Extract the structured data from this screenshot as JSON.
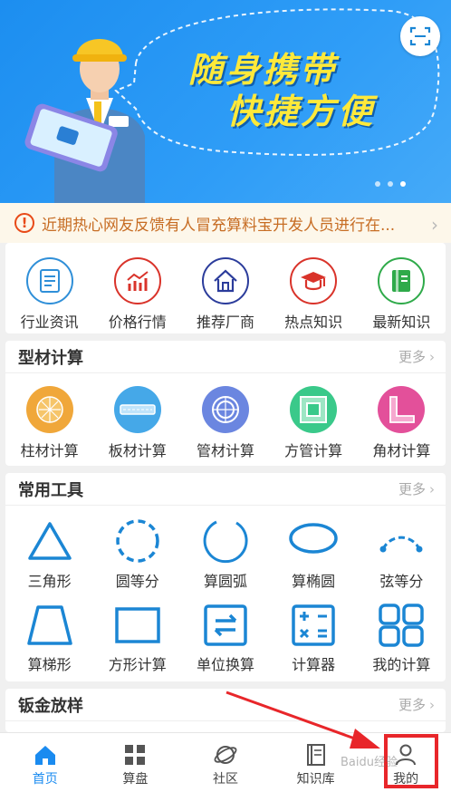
{
  "banner": {
    "slogan_line1": "随身携带",
    "slogan_line2": "快捷方便",
    "scan_icon": "scan-icon",
    "carousel_dots": 3
  },
  "notice": {
    "icon": "alert-icon",
    "icon_text": "!",
    "text": "近期热心网友反馈有人冒充算料宝开发人员进行在...",
    "arrow": "›"
  },
  "quick_nav": {
    "items": [
      {
        "label": "行业资讯",
        "icon": "document-icon",
        "color": "#2f8fd8"
      },
      {
        "label": "价格行情",
        "icon": "bar-chart-icon",
        "color": "#d9332a"
      },
      {
        "label": "推荐厂商",
        "icon": "house-icon",
        "color": "#2b3c9b"
      },
      {
        "label": "热点知识",
        "icon": "graduation-cap-icon",
        "color": "#d9332a"
      },
      {
        "label": "最新知识",
        "icon": "book-icon",
        "color": "#2faa4a"
      }
    ]
  },
  "profile_calc": {
    "title": "型材计算",
    "more": "更多",
    "items": [
      {
        "label": "柱材计算",
        "icon": "column-icon",
        "color": "#f0a73a"
      },
      {
        "label": "板材计算",
        "icon": "plate-icon",
        "color": "#45a8e8"
      },
      {
        "label": "管材计算",
        "icon": "pipe-icon",
        "color": "#6b86e0"
      },
      {
        "label": "方管计算",
        "icon": "square-tube-icon",
        "color": "#3ac98a"
      },
      {
        "label": "角材计算",
        "icon": "angle-icon",
        "color": "#e3509a"
      }
    ]
  },
  "tools": {
    "title": "常用工具",
    "more": "更多",
    "row1": [
      {
        "label": "三角形",
        "icon": "triangle-icon"
      },
      {
        "label": "圆等分",
        "icon": "dashed-circle-icon"
      },
      {
        "label": "算圆弧",
        "icon": "arc-icon"
      },
      {
        "label": "算椭圆",
        "icon": "ellipse-icon"
      },
      {
        "label": "弦等分",
        "icon": "chord-icon"
      }
    ],
    "row2": [
      {
        "label": "算梯形",
        "icon": "trapezoid-icon"
      },
      {
        "label": "方形计算",
        "icon": "rectangle-icon"
      },
      {
        "label": "单位换算",
        "icon": "swap-icon"
      },
      {
        "label": "计算器",
        "icon": "calculator-icon"
      },
      {
        "label": "我的计算",
        "icon": "grid-icon"
      }
    ]
  },
  "sheet_metal": {
    "title": "钣金放样",
    "more": "更多"
  },
  "tabbar": {
    "tabs": [
      {
        "label": "首页",
        "icon": "home-icon",
        "active": true
      },
      {
        "label": "算盘",
        "icon": "grid-icon",
        "active": false
      },
      {
        "label": "社区",
        "icon": "planet-icon",
        "active": false
      },
      {
        "label": "知识库",
        "icon": "book-icon",
        "active": false
      },
      {
        "label": "我的",
        "icon": "user-icon",
        "active": false
      }
    ]
  },
  "colors": {
    "accent": "#1a8bf0",
    "tool_blue": "#1b86d4",
    "highlight": "#e8262a",
    "slogan": "#ffe93a"
  },
  "watermark": "Baidu经验"
}
